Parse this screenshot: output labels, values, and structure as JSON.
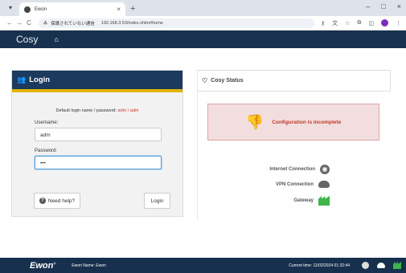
{
  "browser": {
    "tab_title": "Ewon",
    "tab_close": "×",
    "new_tab": "+",
    "window_controls": [
      "–",
      "□",
      "×"
    ],
    "nav": [
      "←",
      "→",
      "C"
    ],
    "security_warning": "保護されていない通信",
    "url": "192.168.3.53/index.shtm#home"
  },
  "app": {
    "brand": "Cosy",
    "home_icon": "home-icon"
  },
  "login": {
    "title": "Login",
    "default_text": "Default login name / password: ",
    "default_creds": "adm / adm",
    "username_label": "Username:",
    "username_value": "adm",
    "password_label": "Password:",
    "password_value": "•••",
    "help_label": "Need help?",
    "login_label": "Login"
  },
  "status": {
    "title": "Cosy Status",
    "alert": "Configuration is incomplete",
    "rows": [
      {
        "label": "Internet Connection",
        "icon": "globe-icon"
      },
      {
        "label": "VPN Connection",
        "icon": "cloud-icon"
      },
      {
        "label": "Gateway",
        "icon": "factory-icon"
      }
    ]
  },
  "footer": {
    "logo": "Ewon",
    "name": "Ewon Name: Ewon",
    "time": "Current time: 11/02/2024 01:32:44"
  },
  "colors": {
    "navy": "#18314f",
    "accent": "#e2b400",
    "alert_bg": "#f2dede",
    "alert_text": "#c0392b",
    "gateway_green": "#3cb54a"
  }
}
